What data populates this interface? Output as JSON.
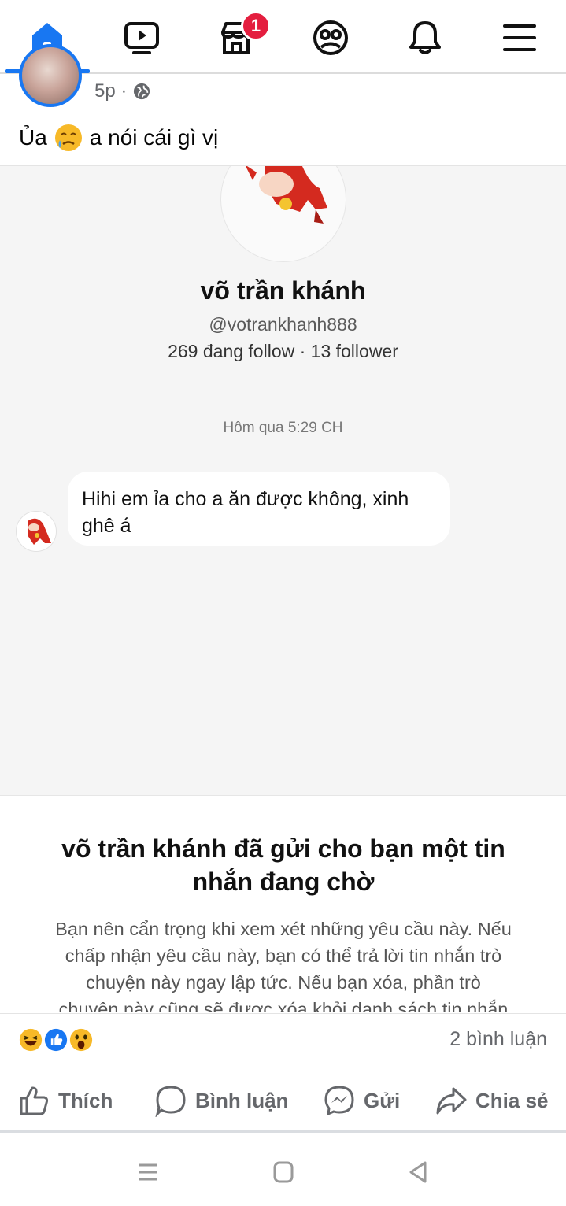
{
  "nav": {
    "items": [
      {
        "name": "home",
        "icon": "home-icon",
        "active": true
      },
      {
        "name": "watch",
        "icon": "video-icon"
      },
      {
        "name": "marketplace",
        "icon": "store-icon",
        "badge": "1"
      },
      {
        "name": "profile",
        "icon": "avatar-icon"
      },
      {
        "name": "notifications",
        "icon": "bell-icon"
      },
      {
        "name": "menu",
        "icon": "hamburger-icon"
      }
    ],
    "marketplace_badge": "1",
    "accent": "#1877f2",
    "badge_color": "#e41e3f"
  },
  "post": {
    "time": "5p ·",
    "caption_before": "Ủa",
    "caption_after": "a nói cái gì vị"
  },
  "screenshot": {
    "profile_name": "võ trần khánh",
    "profile_handle": "@votrankhanh888",
    "profile_stats": "269 đang follow · 13 follower",
    "message_time": "Hôm qua 5:29 CH",
    "message_line1": "Hihi em ỉa cho a ăn được không, xinh",
    "message_line2": "ghê á",
    "card_title_line1": "võ trần khánh đã gửi cho bạn một tin",
    "card_title_line2": "nhắn đang chờ",
    "card_body_line1": "Bạn nên cẩn trọng khi xem xét những yêu cầu này. Nếu",
    "card_body_line2": "chấp nhận yêu cầu này, bạn có thể trả lời tin nhắn trò",
    "card_body_line3": "chuyện này ngay lập tức. Nếu bạn xóa, phần trò",
    "card_body_line4": "chuyện này cũng sẽ được xóa khỏi danh sách tin nhắn"
  },
  "reactions": {
    "icons": [
      "haha-icon",
      "like-icon",
      "wow-icon"
    ],
    "comments": "2 bình luận"
  },
  "actions": {
    "like": "Thích",
    "comment": "Bình luận",
    "send": "Gửi",
    "share": "Chia sẻ"
  }
}
